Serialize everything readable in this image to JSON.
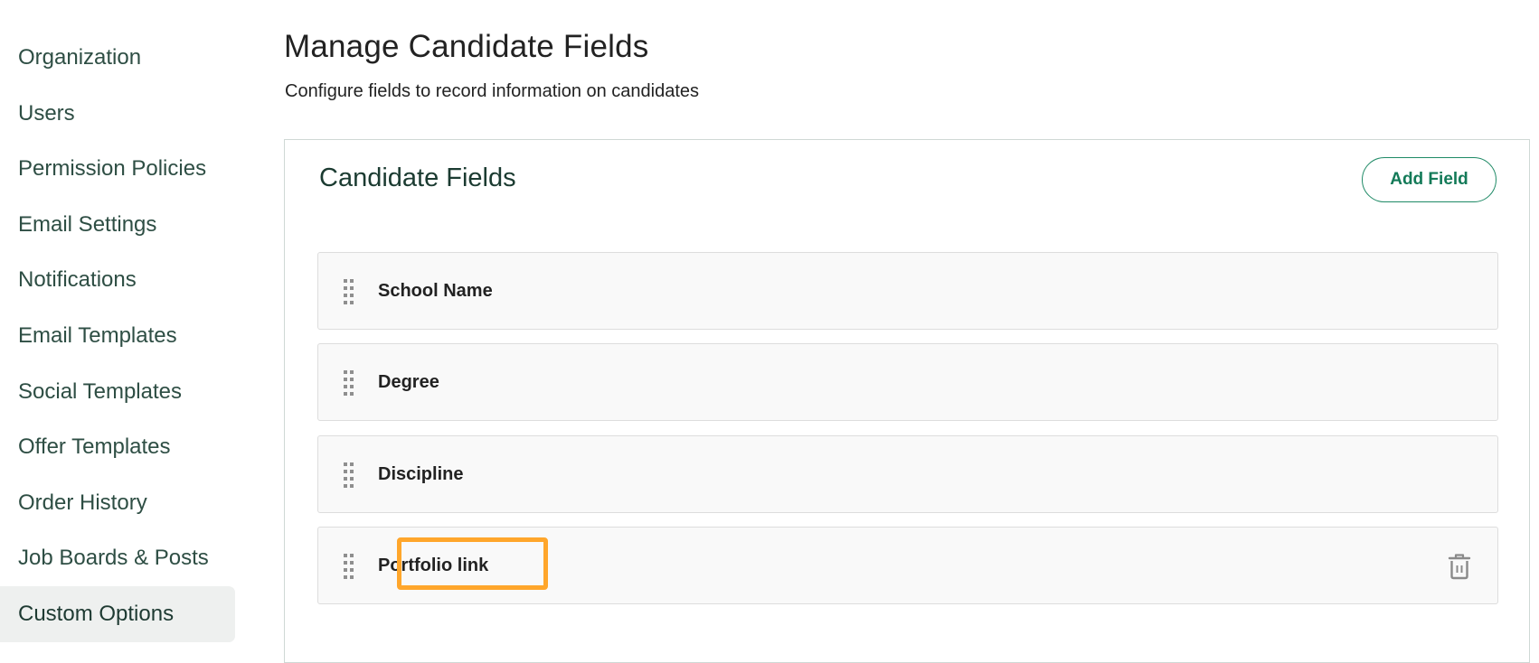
{
  "sidebar": {
    "items": [
      {
        "label": "Organization",
        "active": false
      },
      {
        "label": "Users",
        "active": false
      },
      {
        "label": "Permission Policies",
        "active": false
      },
      {
        "label": "Email Settings",
        "active": false
      },
      {
        "label": "Notifications",
        "active": false
      },
      {
        "label": "Email Templates",
        "active": false
      },
      {
        "label": "Social Templates",
        "active": false
      },
      {
        "label": "Offer Templates",
        "active": false
      },
      {
        "label": "Order History",
        "active": false
      },
      {
        "label": "Job Boards & Posts",
        "active": false
      },
      {
        "label": "Custom Options",
        "active": true
      }
    ]
  },
  "header": {
    "title": "Manage Candidate Fields",
    "subtitle": "Configure fields to record information on candidates"
  },
  "panel": {
    "title": "Candidate Fields",
    "add_button_label": "Add Field",
    "fields": [
      {
        "label": "School Name",
        "deletable": false,
        "highlighted": false
      },
      {
        "label": "Degree",
        "deletable": false,
        "highlighted": false
      },
      {
        "label": "Discipline",
        "deletable": false,
        "highlighted": false
      },
      {
        "label": "Portfolio link",
        "deletable": true,
        "highlighted": true
      }
    ]
  },
  "colors": {
    "accent": "#137a58",
    "highlight": "#ffa62b",
    "sidebar_text": "#2e4e44",
    "active_bg": "#eef0ef"
  },
  "icons": {
    "drag": "drag-handle-icon",
    "delete": "trash-icon"
  }
}
